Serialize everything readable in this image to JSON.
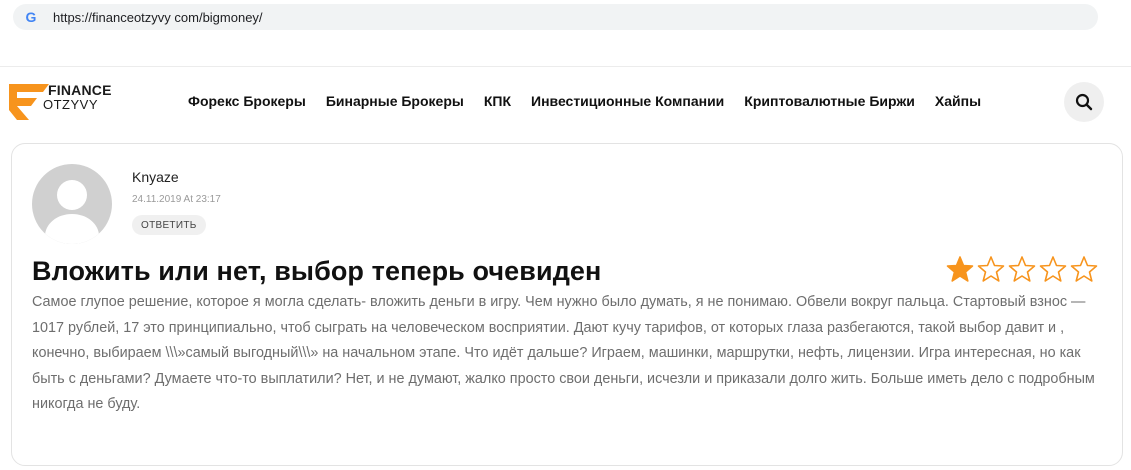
{
  "browser": {
    "url": "https://financeotzyvy com/bigmoney/"
  },
  "header": {
    "logo_line1": "FINANCE",
    "logo_line2": "OTZYVY",
    "nav": [
      "Форекс Брокеры",
      "Бинарные Брокеры",
      "КПК",
      "Инвестиционные Компании",
      "Криптовалютные Биржи",
      "Хайпы"
    ]
  },
  "review": {
    "author": "Knyaze",
    "date": "24.11.2019 At 23:17",
    "reply_label": "ОТВЕТИТЬ",
    "title": "Вложить или нет, выбор теперь очевиден",
    "rating": 1,
    "rating_max": 5,
    "body": "Самое глупое решение, которое я могла сделать- вложить деньги в игру. Чем нужно было думать, я не понимаю. Обвели вокруг пальца. Стартовый взнос — 1017 рублей, 17 это принципиально, чтоб сыграть на человеческом восприятии. Дают кучу тарифов, от которых глаза разбегаются, такой выбор давит и , конечно, выбираем \\\\\\»самый выгодный\\\\\\» на начальном этапе. Что идёт дальше? Играем, машинки, маршрутки, нефть, лицензии. Игра интересная, но как быть с деньгами? Думаете что-то выплатили? Нет, и не думают, жалко просто свои деньги, исчезли и приказали долго жить. Больше иметь дело с подробным никогда не буду."
  },
  "colors": {
    "accent_orange": "#f7941d",
    "star_filled": "#f7941d",
    "text_gray": "#6e6e6e"
  },
  "icons": {
    "browser": "google-g-icon",
    "search": "search-icon",
    "avatar": "default-user-avatar"
  }
}
